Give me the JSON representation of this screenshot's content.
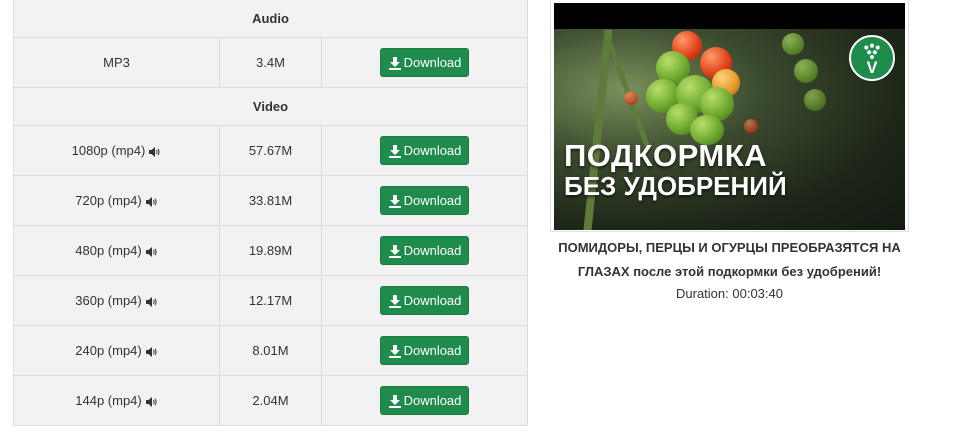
{
  "audio_section": {
    "heading": "Audio"
  },
  "audio_rows": [
    {
      "format": "MP3",
      "size": "3.4M",
      "button": "Download",
      "has_sound_icon": false
    }
  ],
  "video_section": {
    "heading": "Video"
  },
  "video_rows": [
    {
      "format": "1080p (mp4)",
      "size": "57.67M",
      "button": "Download"
    },
    {
      "format": "720p (mp4)",
      "size": "33.81M",
      "button": "Download"
    },
    {
      "format": "480p (mp4)",
      "size": "19.89M",
      "button": "Download"
    },
    {
      "format": "360p (mp4)",
      "size": "12.17M",
      "button": "Download"
    },
    {
      "format": "240p (mp4)",
      "size": "8.01M",
      "button": "Download"
    },
    {
      "format": "144p (mp4)",
      "size": "2.04M",
      "button": "Download"
    }
  ],
  "thumbnail": {
    "overlay_line1": "ПОДКОРМКА",
    "overlay_line2": "БЕЗ УДОБРЕНИЙ",
    "logo_letter": "V"
  },
  "video_info": {
    "title": "ПОМИДОРЫ, ПЕРЦЫ И ОГУРЦЫ ПРЕОБРАЗЯТСЯ НА ГЛАЗАХ после этой подкормки без удобрений!",
    "duration_label": "Duration:",
    "duration": "00:03:40"
  },
  "colors": {
    "button_bg": "#1f8b4c",
    "table_bg": "#f2f2f2",
    "border": "#dddddd"
  },
  "icons": {
    "download": "download-arrow-icon",
    "speaker": "speaker-icon"
  }
}
